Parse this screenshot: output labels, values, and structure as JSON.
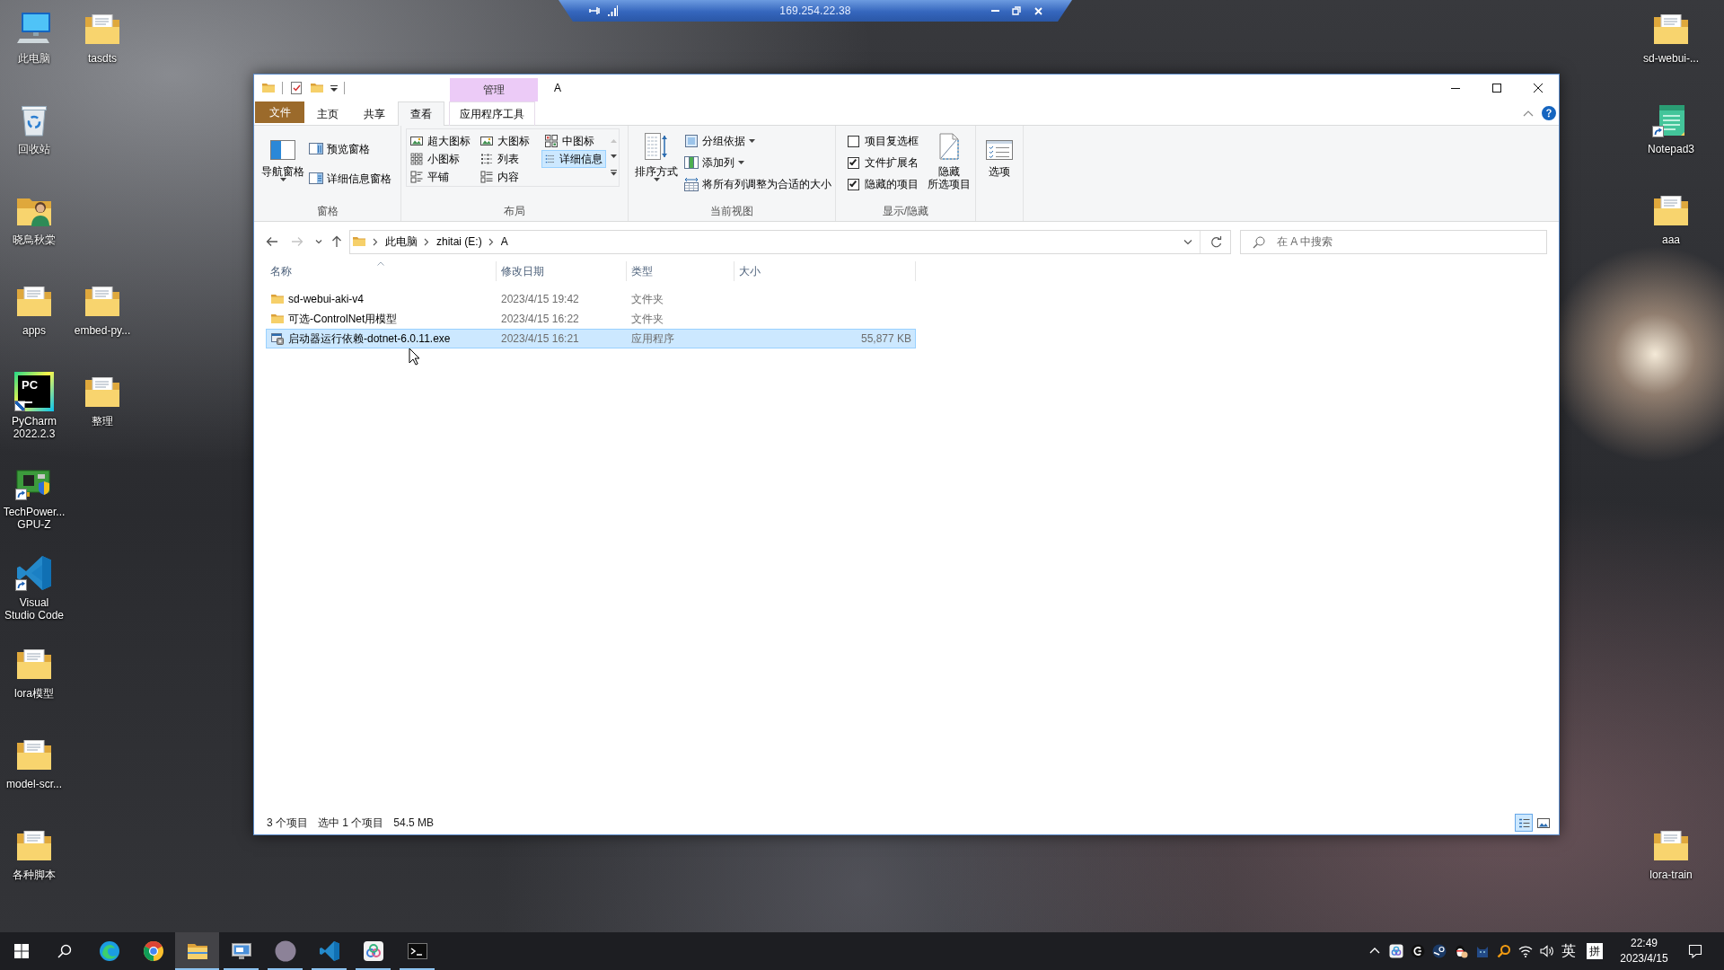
{
  "remote_bar": {
    "address": "169.254.22.38"
  },
  "desktop": {
    "icons": [
      {
        "label": "此电脑",
        "kind": "computer",
        "shortcut": false
      },
      {
        "label": "回收站",
        "kind": "recycle_bin",
        "shortcut": false
      },
      {
        "label": "晓鳥秋棠",
        "kind": "user_folder",
        "shortcut": false
      },
      {
        "label": "apps",
        "kind": "document_folder",
        "shortcut": false
      },
      {
        "label": "PyCharm\n2022.2.3",
        "kind": "logo_tile",
        "logo_text": "PC",
        "shortcut": true
      },
      {
        "label": "TechPower...\nGPU-Z",
        "kind": "circuit_board",
        "shortcut": true
      },
      {
        "label": "Visual\nStudio Code",
        "kind": "ribbon_logo",
        "shortcut": true
      },
      {
        "label": "lora模型",
        "kind": "document_folder",
        "shortcut": false
      },
      {
        "label": "model-scr...",
        "kind": "document_folder",
        "shortcut": false
      },
      {
        "label": "各种脚本",
        "kind": "document_folder",
        "shortcut": false
      },
      {
        "label": "tasdts",
        "kind": "document_folder",
        "shortcut": false
      },
      {
        "label": "embed-py...",
        "kind": "document_folder",
        "shortcut": false
      },
      {
        "label": "整理",
        "kind": "document_folder",
        "shortcut": false
      },
      {
        "label": "sd-webui-...",
        "kind": "document_folder",
        "shortcut": false
      },
      {
        "label": "Notepad3",
        "kind": "notepad",
        "shortcut": true
      },
      {
        "label": "aaa",
        "kind": "document_folder",
        "shortcut": false
      },
      {
        "label": "lora-train",
        "kind": "document_folder",
        "shortcut": false
      }
    ]
  },
  "explorer": {
    "title": "A",
    "context_group": "管理",
    "tabs": [
      {
        "label": "文件",
        "kind": "file",
        "selected": false
      },
      {
        "label": "主页",
        "kind": "tab",
        "selected": false
      },
      {
        "label": "共享",
        "kind": "tab",
        "selected": false
      },
      {
        "label": "查看",
        "kind": "tab",
        "selected": true
      },
      {
        "label": "应用程序工具",
        "kind": "context",
        "selected": false
      }
    ],
    "ribbon": {
      "panes": {
        "label": "窗格",
        "items": [
          {
            "label": "导航窗格",
            "kind": "navigation",
            "dropdown": true
          },
          {
            "label": "预览窗格",
            "kind": "preview",
            "dropdown": false
          },
          {
            "label": "详细信息窗格",
            "kind": "details",
            "dropdown": false
          }
        ]
      },
      "layout": {
        "label": "布局",
        "options": [
          {
            "label": "超大图标",
            "kind": "extra_large",
            "selected": false
          },
          {
            "label": "大图标",
            "kind": "large",
            "selected": false
          },
          {
            "label": "中图标",
            "kind": "medium",
            "selected": false
          },
          {
            "label": "小图标",
            "kind": "small",
            "selected": false
          },
          {
            "label": "列表",
            "kind": "list",
            "selected": false
          },
          {
            "label": "详细信息",
            "kind": "details",
            "selected": true
          },
          {
            "label": "平铺",
            "kind": "tiles",
            "selected": false
          },
          {
            "label": "内容",
            "kind": "content",
            "selected": false
          }
        ]
      },
      "current_view": {
        "label": "当前视图",
        "items": [
          {
            "label": "排序方式",
            "kind": "sort",
            "dropdown": true
          },
          {
            "label": "分组依据",
            "kind": "group_by",
            "dropdown": true
          },
          {
            "label": "添加列",
            "kind": "add_column",
            "dropdown": true
          },
          {
            "label": "将所有列调整为合适的大小",
            "kind": "fit_columns",
            "dropdown": false
          }
        ]
      },
      "show_hide": {
        "label": "显示/隐藏",
        "checks": [
          {
            "label": "项目复选框",
            "checked": false
          },
          {
            "label": "文件扩展名",
            "checked": true
          },
          {
            "label": "隐藏的项目",
            "checked": true
          }
        ],
        "hide_selected_lines": [
          "隐藏",
          "所选项目"
        ]
      },
      "options": {
        "label": "选项"
      }
    },
    "navigation": [
      {
        "kind": "back",
        "disabled": false
      },
      {
        "kind": "forward",
        "disabled": true
      },
      {
        "kind": "recent",
        "disabled": false
      },
      {
        "kind": "up",
        "disabled": false
      }
    ],
    "address": {
      "path": [
        "此电脑",
        "zhitai (E:)",
        "A"
      ]
    },
    "search": {
      "placeholder": "在 A 中搜索"
    },
    "columns": [
      {
        "label": "名称",
        "sorted": true
      },
      {
        "label": "修改日期",
        "sorted": false
      },
      {
        "label": "类型",
        "sorted": false
      },
      {
        "label": "大小",
        "sorted": false
      }
    ],
    "rows": [
      {
        "name": "sd-webui-aki-v4",
        "modified": "2023/4/15 19:42",
        "type": "文件夹",
        "kind": "folder",
        "selected": false
      },
      {
        "name": "可选-ControlNet用模型",
        "modified": "2023/4/15 16:22",
        "type": "文件夹",
        "kind": "folder",
        "selected": false
      },
      {
        "name": "启动器运行依赖-dotnet-6.0.11.exe",
        "modified": "2023/4/15 16:21",
        "type": "应用程序",
        "size": "55,877 KB",
        "kind": "application",
        "selected": true
      }
    ],
    "status": {
      "item_count": "3 个项目",
      "selection": "选中 1 个项目",
      "selection_size": "54.5 MB"
    },
    "view_buttons": [
      {
        "kind": "details",
        "selected": true
      },
      {
        "kind": "large_icons",
        "selected": false
      }
    ]
  },
  "taskbar": {
    "apps": [
      {
        "kind": "browser_swirl",
        "running": false,
        "selected": false
      },
      {
        "kind": "browser_round",
        "running": false,
        "selected": false
      },
      {
        "kind": "folder",
        "running": true,
        "selected": true
      },
      {
        "kind": "monitor",
        "running": true,
        "selected": false
      },
      {
        "kind": "avatar",
        "running": true,
        "selected": false
      },
      {
        "kind": "ribbon_logo",
        "running": true,
        "selected": false
      },
      {
        "kind": "app_tile",
        "running": true,
        "selected": false
      },
      {
        "kind": "terminal",
        "running": true,
        "selected": false
      }
    ],
    "tray": {
      "language": "英",
      "ime_mode": "拼",
      "time": "22:49",
      "date": "2023/4/15"
    }
  }
}
